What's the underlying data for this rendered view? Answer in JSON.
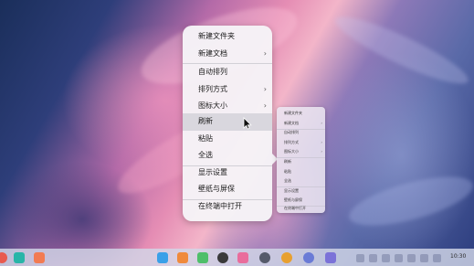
{
  "menu_large": {
    "items": [
      {
        "label": "新建文件夹",
        "submenu": false
      },
      {
        "label": "新建文档",
        "submenu": true
      },
      {
        "label": "自动排列",
        "submenu": false
      },
      {
        "label": "排列方式",
        "submenu": true
      },
      {
        "label": "图标大小",
        "submenu": true
      },
      {
        "label": "刷新",
        "submenu": false,
        "hovered": true
      },
      {
        "label": "粘贴",
        "submenu": false
      },
      {
        "label": "全选",
        "submenu": false
      },
      {
        "label": "显示设置",
        "submenu": false
      },
      {
        "label": "壁纸与屏保",
        "submenu": false
      },
      {
        "label": "在终端中打开",
        "submenu": false
      }
    ],
    "chevron": "›"
  },
  "menu_small": {
    "items": [
      {
        "label": "新建文件夹",
        "submenu": false
      },
      {
        "label": "新建文档",
        "submenu": true
      },
      {
        "label": "自动排列",
        "submenu": false
      },
      {
        "label": "排列方式",
        "submenu": true
      },
      {
        "label": "图标大小",
        "submenu": true
      },
      {
        "label": "刷新",
        "submenu": false
      },
      {
        "label": "粘贴",
        "submenu": false
      },
      {
        "label": "全选",
        "submenu": false
      },
      {
        "label": "显示设置",
        "submenu": false
      },
      {
        "label": "壁纸与屏保",
        "submenu": false
      },
      {
        "label": "在终端中打开",
        "submenu": false
      }
    ],
    "chevron": "›"
  },
  "taskbar": {
    "clock": "10:30",
    "apps": [
      {
        "name": "launcher-icon",
        "color": "#e85a4f"
      },
      {
        "name": "multitask-view-icon",
        "color": "#28b5a8"
      },
      {
        "name": "file-manager-icon",
        "color": "#f27b52"
      },
      {
        "name": "app-store-icon",
        "color": "#3aa0e8"
      },
      {
        "name": "calendar-icon",
        "color": "#f08a3c"
      },
      {
        "name": "music-icon",
        "color": "#4fbf6a"
      },
      {
        "name": "video-player-icon",
        "color": "#3a3a3a"
      },
      {
        "name": "photo-viewer-icon",
        "color": "#e96d9c"
      },
      {
        "name": "camera-icon",
        "color": "#555a6a"
      },
      {
        "name": "browser-icon",
        "color": "#e8a030"
      },
      {
        "name": "control-center-icon",
        "color": "#6a7bd6"
      },
      {
        "name": "settings-icon",
        "color": "#7b72d8"
      }
    ]
  }
}
